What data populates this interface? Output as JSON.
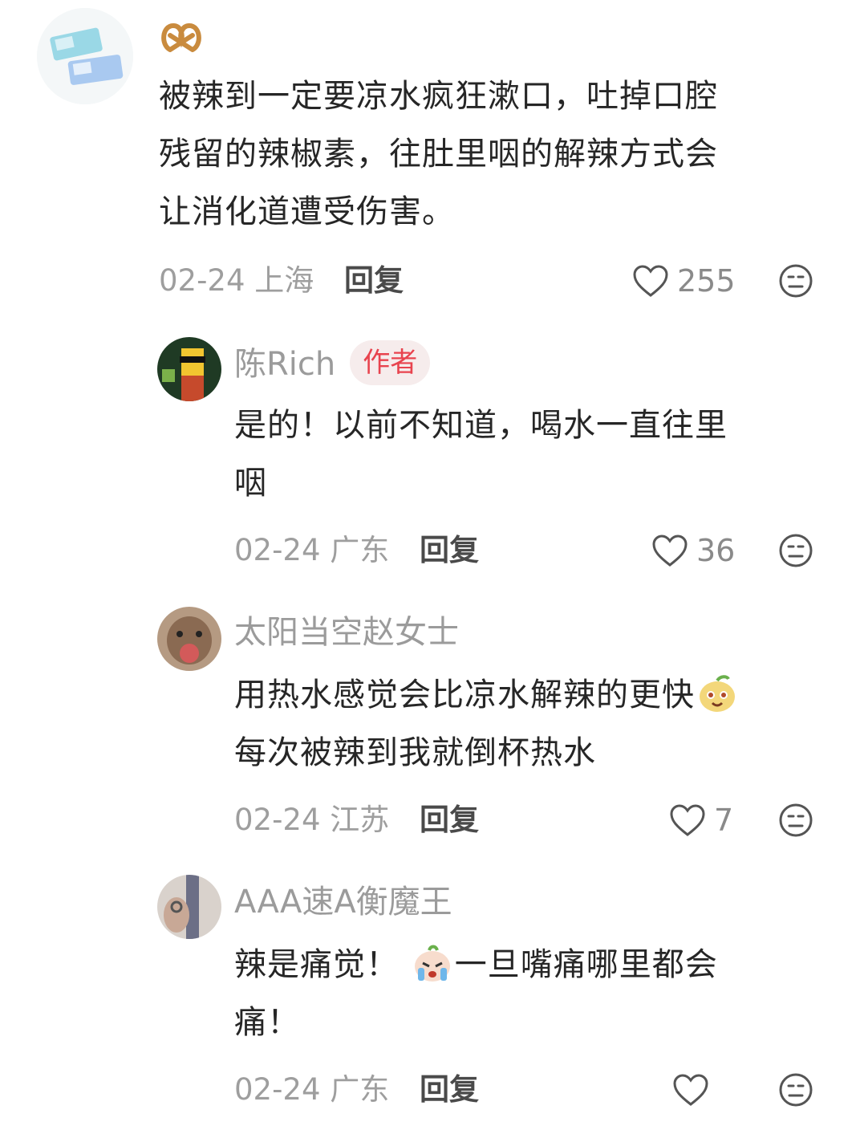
{
  "comments": [
    {
      "username": "",
      "text": "被辣到一定要凉水疯狂漱口，吐掉口腔残留的辣椒素，往肚里咽的解辣方式会让消化道遭受伤害。",
      "lines": [
        "被辣到一定要凉水疯狂漱口，吐掉口腔",
        "残留的辣椒素，往肚里咽的解辣方式会",
        "让消化道遭受伤害。"
      ],
      "date": "02-24",
      "location": "上海",
      "reply_label": "回复",
      "likes": "255",
      "name_icon": "pretzel-icon"
    },
    {
      "username": "陈Rich",
      "badge": "作者",
      "lines": [
        "是的！以前不知道，喝水一直往里",
        "咽"
      ],
      "date": "02-24",
      "location": "广东",
      "reply_label": "回复",
      "likes": "36"
    },
    {
      "username": "太阳当空赵女士",
      "lines_a": "用热水感觉会比凉水解辣的更快",
      "emoji_a": "cute-face-emoji",
      "lines_b": "每次被辣到我就倒杯热水",
      "date": "02-24",
      "location": "江苏",
      "reply_label": "回复",
      "likes": "7"
    },
    {
      "username": "AAA速A衡魔王",
      "line1_a": "辣是痛觉！",
      "emoji_a": "crying-face-emoji",
      "line1_b": "一旦嘴痛哪里都会",
      "line2": "痛！",
      "date": "02-24",
      "location": "广东",
      "reply_label": "回复",
      "likes": ""
    }
  ],
  "colors": {
    "accent": "#e8434e",
    "muted": "#9e9e9e"
  }
}
